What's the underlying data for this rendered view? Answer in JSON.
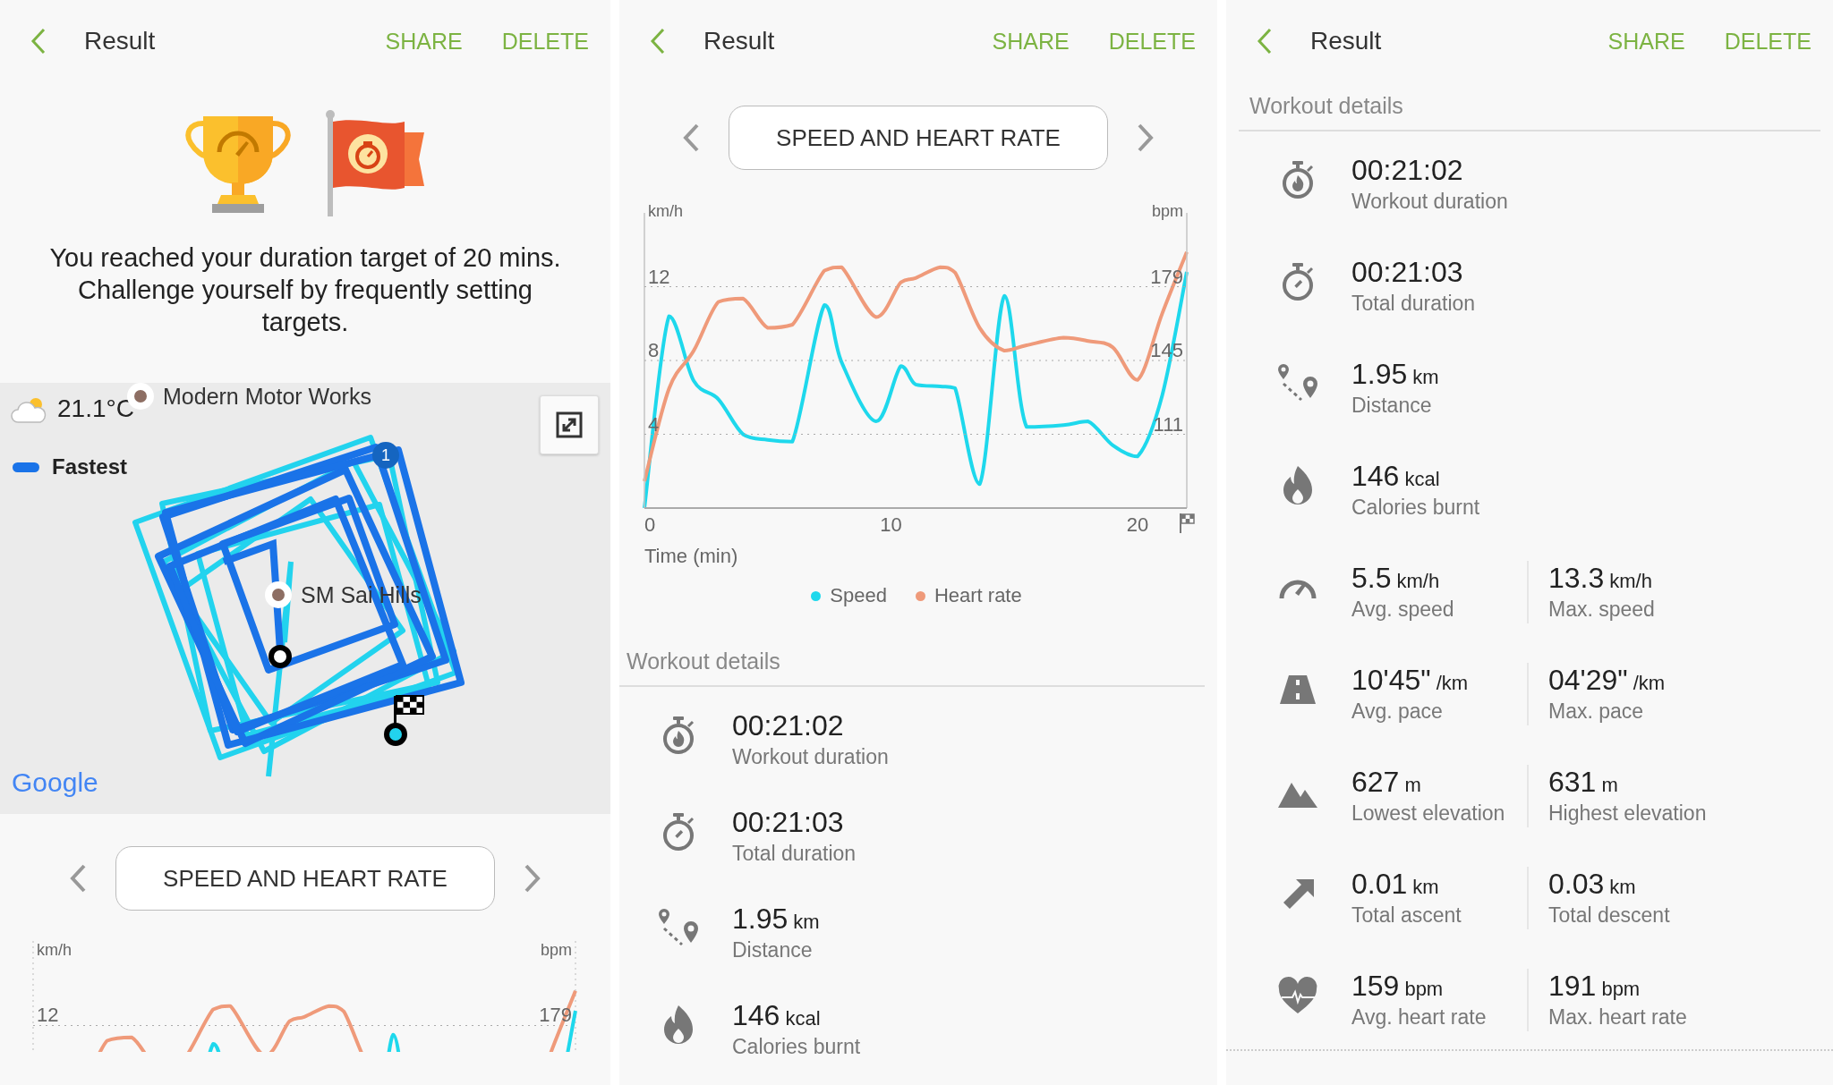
{
  "screens": [
    {
      "header": {
        "title": "Result",
        "actions": [
          "SHARE",
          "DELETE"
        ]
      },
      "achievement": {
        "message": "You reached your duration target of 20 mins. Challenge yourself by frequently setting targets."
      },
      "map": {
        "weather": "21.1°C",
        "legend": "Fastest",
        "places": [
          "Modern Motor Works",
          "SM Sai Hills"
        ],
        "lap_marker": "1",
        "attribution": "Google"
      },
      "chart_selector": {
        "title": "SPEED AND HEART RATE"
      },
      "chart_preview": {
        "ylabel": "km/h",
        "y2label": "bpm",
        "ytick": "12",
        "y2tick": "179"
      }
    },
    {
      "header": {
        "title": "Result",
        "actions": [
          "SHARE",
          "DELETE"
        ]
      },
      "chart_selector": {
        "title": "SPEED AND HEART RATE"
      },
      "chart_data": {
        "type": "line",
        "xlabel": "Time (min)",
        "ylabel": "km/h",
        "y2label": "bpm",
        "x": [
          0,
          1,
          2,
          3,
          4,
          5,
          6,
          7.3,
          8,
          9.4,
          10.4,
          11,
          12,
          12.6,
          13.6,
          14.6,
          15.5,
          17,
          18,
          19,
          20,
          21,
          22
        ],
        "xlim": [
          0,
          22
        ],
        "ylim": [
          0,
          16
        ],
        "y2lim": [
          77,
          213
        ],
        "xticks": [
          0,
          10,
          20
        ],
        "yticks": [
          4,
          8,
          12
        ],
        "y2ticks": [
          111,
          145,
          179
        ],
        "grid": true,
        "legend": true,
        "series": [
          {
            "name": "Speed",
            "color": "#1ed8ec",
            "values": [
              0,
              10.4,
              6.9,
              5.9,
              4.0,
              3.7,
              3.6,
              11.0,
              7.9,
              4.7,
              7.7,
              6.7,
              6.6,
              6.5,
              1.3,
              11.5,
              4.4,
              4.5,
              4.7,
              3.4,
              2.8,
              6.1,
              12.8
            ]
          },
          {
            "name": "Heart rate",
            "color": "#ef9a7a",
            "axis": "y2",
            "values": [
              89.4,
              132,
              149.5,
              172,
              173.5,
              160,
              161.5,
              186.4,
              188,
              165,
              181,
              183,
              188,
              185.5,
              160,
              149.5,
              152,
              155.5,
              154,
              151,
              136,
              166.6,
              195
            ]
          }
        ]
      },
      "details": {
        "title": "Workout details",
        "rows": [
          {
            "kind": "single",
            "items": [
              {
                "value": "00:21:02",
                "label": "Workout duration"
              }
            ]
          },
          {
            "kind": "single",
            "items": [
              {
                "value": "00:21:03",
                "label": "Total duration"
              }
            ]
          },
          {
            "kind": "single",
            "items": [
              {
                "value": "1.95",
                "unit": "km",
                "label": "Distance"
              }
            ]
          },
          {
            "kind": "single",
            "items": [
              {
                "value": "146",
                "unit": "kcal",
                "label": "Calories burnt"
              }
            ]
          }
        ]
      }
    },
    {
      "header": {
        "title": "Result",
        "actions": [
          "SHARE",
          "DELETE"
        ]
      },
      "details": {
        "title": "Workout details",
        "rows": [
          {
            "kind": "single",
            "items": [
              {
                "value": "00:21:02",
                "label": "Workout duration"
              }
            ]
          },
          {
            "kind": "single",
            "items": [
              {
                "value": "00:21:03",
                "label": "Total duration"
              }
            ]
          },
          {
            "kind": "single",
            "items": [
              {
                "value": "1.95",
                "unit": "km",
                "label": "Distance"
              }
            ]
          },
          {
            "kind": "single",
            "items": [
              {
                "value": "146",
                "unit": "kcal",
                "label": "Calories burnt"
              }
            ]
          },
          {
            "kind": "pair",
            "items": [
              {
                "value": "5.5",
                "unit": "km/h",
                "label": "Avg. speed"
              },
              {
                "value": "13.3",
                "unit": "km/h",
                "label": "Max. speed"
              }
            ]
          },
          {
            "kind": "pair",
            "items": [
              {
                "value": "10'45\"",
                "unit": "/km",
                "label": "Avg. pace"
              },
              {
                "value": "04'29\"",
                "unit": "/km",
                "label": "Max. pace"
              }
            ]
          },
          {
            "kind": "pair",
            "items": [
              {
                "value": "627",
                "unit": "m",
                "label": "Lowest elevation"
              },
              {
                "value": "631",
                "unit": "m",
                "label": "Highest elevation"
              }
            ]
          },
          {
            "kind": "pair",
            "items": [
              {
                "value": "0.01",
                "unit": "km",
                "label": "Total ascent"
              },
              {
                "value": "0.03",
                "unit": "km",
                "label": "Total descent"
              }
            ]
          },
          {
            "kind": "pair",
            "items": [
              {
                "value": "159",
                "unit": "bpm",
                "label": "Avg. heart rate"
              },
              {
                "value": "191",
                "unit": "bpm",
                "label": "Max. heart rate"
              }
            ]
          }
        ]
      }
    }
  ]
}
